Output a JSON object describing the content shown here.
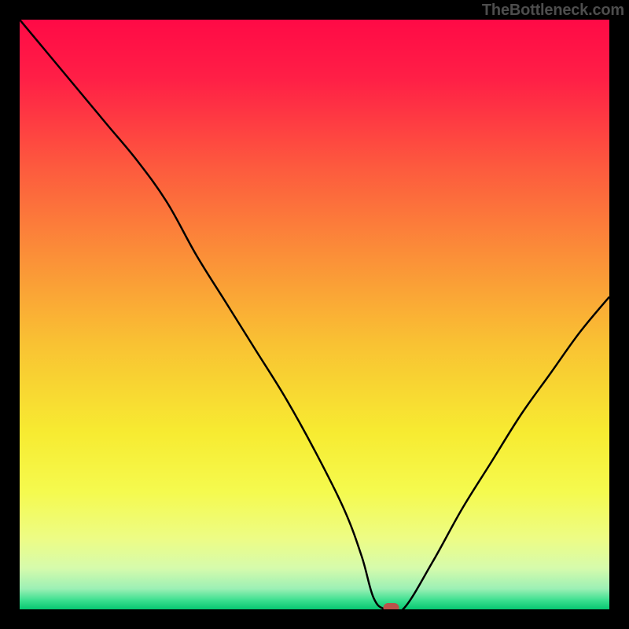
{
  "watermark": "TheBottleneck.com",
  "marker": {
    "color": "#b9524a"
  },
  "chart_data": {
    "type": "line",
    "title": "",
    "xlabel": "",
    "ylabel": "",
    "xlim": [
      0,
      100
    ],
    "ylim": [
      0,
      100
    ],
    "grid": false,
    "legend": false,
    "note": "Bottleneck curve. Y-axis is bottleneck percentage (0 at bottom, ~100 at top). Curve reaches minimum (~0%) near x≈63, marked with a red pill.",
    "series": [
      {
        "name": "bottleneck_curve",
        "x": [
          0,
          5,
          10,
          15,
          20,
          25,
          30,
          35,
          40,
          45,
          50,
          55,
          58,
          60,
          62,
          65,
          70,
          75,
          80,
          85,
          90,
          95,
          100
        ],
        "values": [
          100,
          94,
          88,
          82,
          76,
          69,
          60,
          52,
          44,
          36,
          27,
          17,
          9,
          2,
          0,
          0,
          8,
          17,
          25,
          33,
          40,
          47,
          53
        ]
      }
    ],
    "marker_point": {
      "x": 63,
      "y": 0
    },
    "gradient_stops": [
      {
        "offset": 0.0,
        "color": "#ff0a46"
      },
      {
        "offset": 0.1,
        "color": "#ff1f46"
      },
      {
        "offset": 0.25,
        "color": "#fd5a3e"
      },
      {
        "offset": 0.4,
        "color": "#fb8f38"
      },
      {
        "offset": 0.55,
        "color": "#f9c233"
      },
      {
        "offset": 0.7,
        "color": "#f7eb31"
      },
      {
        "offset": 0.8,
        "color": "#f5fa4e"
      },
      {
        "offset": 0.88,
        "color": "#edfc85"
      },
      {
        "offset": 0.93,
        "color": "#d6fbac"
      },
      {
        "offset": 0.965,
        "color": "#9cf0b5"
      },
      {
        "offset": 0.985,
        "color": "#3adf8f"
      },
      {
        "offset": 1.0,
        "color": "#07c771"
      }
    ]
  }
}
